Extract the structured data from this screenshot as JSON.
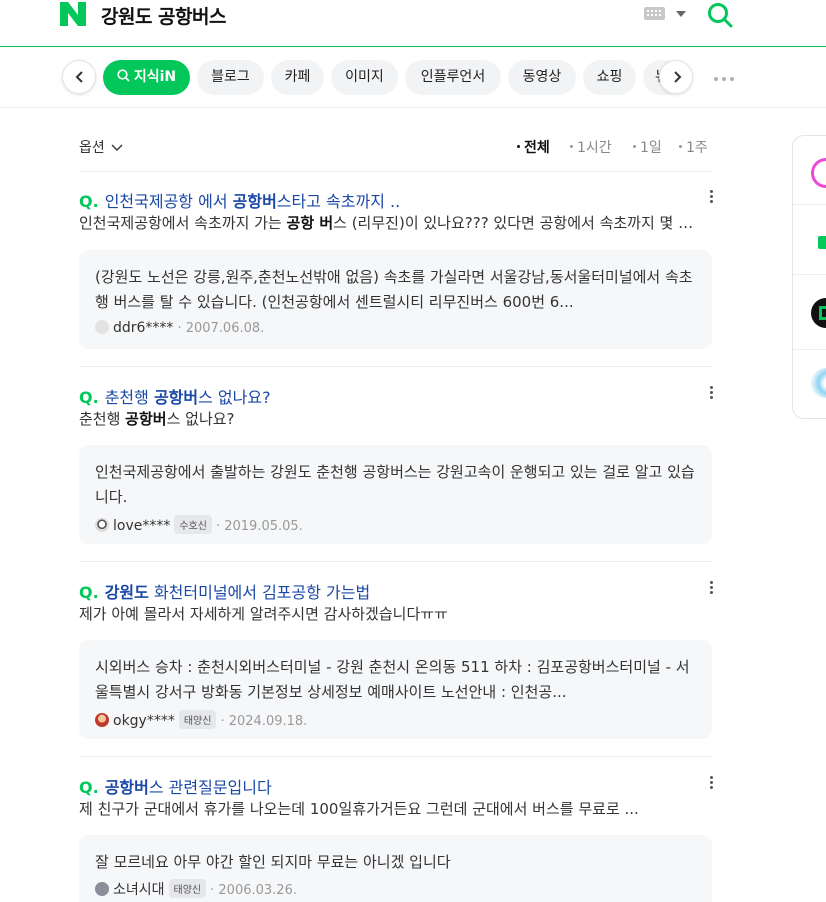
{
  "header": {
    "logo": "N",
    "query": "강원도 공항버스",
    "keyboard_icon": "keyboard-icon",
    "search_icon": "search-icon",
    "brand_color": "#03c75a"
  },
  "tabs": [
    {
      "label": "지식iN",
      "active": true
    },
    {
      "label": "블로그",
      "active": false
    },
    {
      "label": "카페",
      "active": false
    },
    {
      "label": "이미지",
      "active": false
    },
    {
      "label": "인플루언서",
      "active": false
    },
    {
      "label": "동영상",
      "active": false
    },
    {
      "label": "쇼핑",
      "active": false
    },
    {
      "label": "뉴",
      "active": false
    }
  ],
  "filter": {
    "options_label": "옵션",
    "periods": [
      {
        "label": "전체",
        "selected": true
      },
      {
        "label": "1시간",
        "selected": false
      },
      {
        "label": "1일",
        "selected": false
      },
      {
        "label": "1주",
        "selected": false
      }
    ]
  },
  "results": [
    {
      "title_parts": [
        "인천국제공항 에서 ",
        "공항버",
        "스타고 속초까지 .."
      ],
      "desc_parts": [
        "인천국제공항에서 속초까지 가는 ",
        "공항 버",
        "스 (리무진)이 있나요??? 있다면 공항에서 속초까지 몇 시간 걸리나요?"
      ],
      "answer": "(강원도 노선은 강릉,원주,춘천노선밖애 없음) 속초를 가실라면 서울강남,동서울터미널에서 속초행 버스를 탈 수 있습니다. (인천공항에서 센트럴시티 리무진버스 600번 6...",
      "user": "ddr6****",
      "badge": "",
      "date": "2007.06.08."
    },
    {
      "title_parts": [
        "춘천행 ",
        "공항버",
        "스 없나요?"
      ],
      "desc_parts": [
        "춘천행 ",
        "공항버",
        "스 없나요?"
      ],
      "answer": "인천국제공항에서 출발하는 강원도 춘천행 공항버스는 강원고속이 운행되고 있는 걸로 알고 있습니다.",
      "user": "love****",
      "badge": "수호신",
      "date": "2019.05.05."
    },
    {
      "title_parts": [
        "",
        "강원도",
        " 화천터미널에서 김포공항 가는법"
      ],
      "desc_parts": [
        "제가 아예 몰라서 자세하게 알려주시면 감사하겠습니다ㅠㅠ",
        "",
        ""
      ],
      "answer": "시외버스 승차 : 춘천시외버스터미널 - 강원 춘천시 온의동 511 하차 : 김포공항버스터미널 - 서울특별시 강서구 방화동 기본정보 상세정보 예매사이트 노선안내 : 인천공...",
      "user": "okgy****",
      "badge": "태양신",
      "date": "2024.09.18."
    },
    {
      "title_parts": [
        "",
        "공항버",
        "스 관련질문입니다"
      ],
      "desc_parts": [
        "제 친구가 군대에서 휴가를 나오는데 100일휴가거든요 그런데 군대에서 버스를 무료로 ...",
        "",
        ""
      ],
      "answer": "잘 모르네요 아무 야간 할인 되지마 무료는 아니겠 입니다",
      "user": "소녀시대",
      "badge": "태양신",
      "date": "2006.03.26."
    }
  ]
}
